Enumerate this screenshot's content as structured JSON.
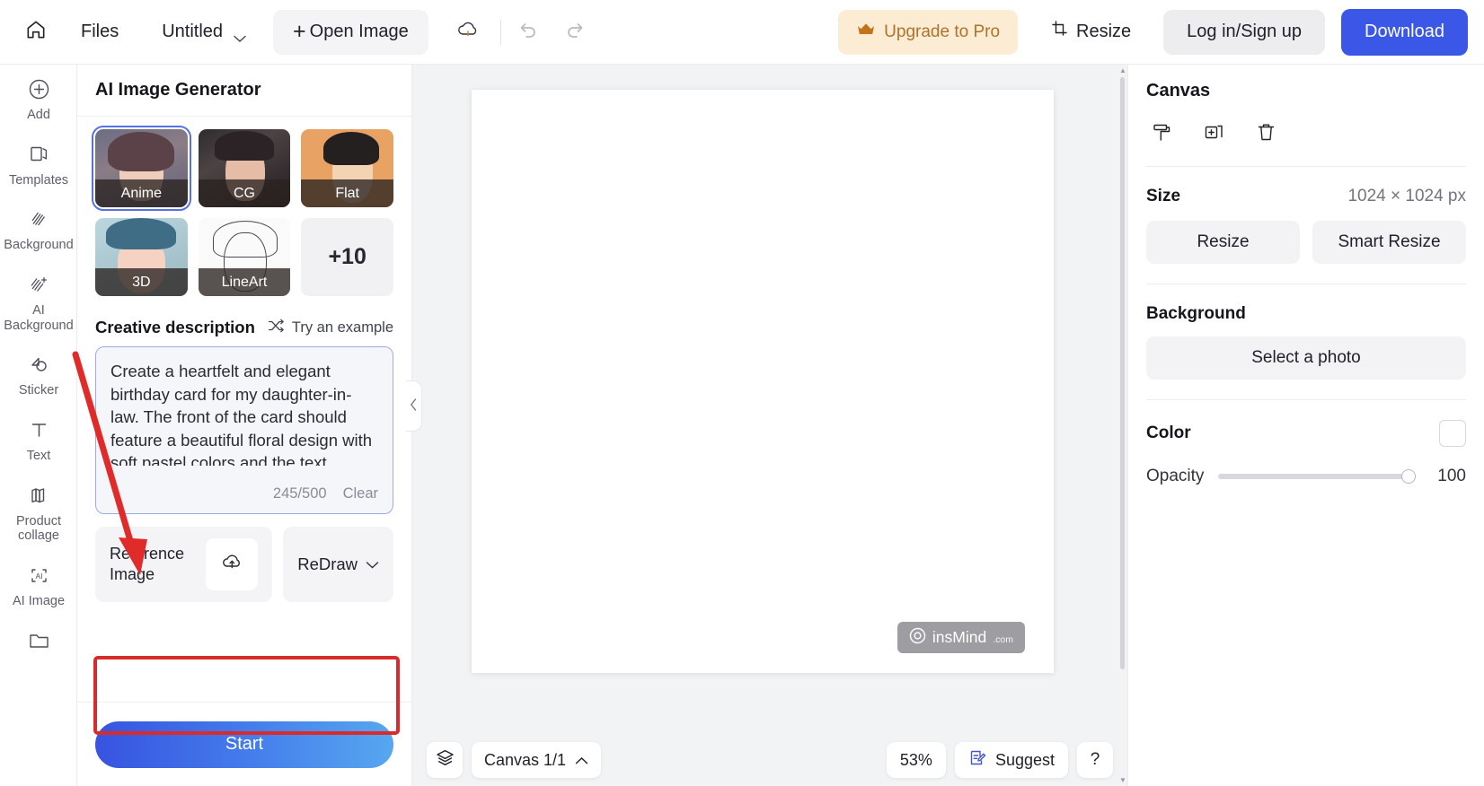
{
  "topbar": {
    "home_icon": "home-icon",
    "files_label": "Files",
    "document_name": "Untitled",
    "open_image_label": "Open Image",
    "open_image_plus": "+",
    "cloud_icon": "cloud-save-icon",
    "undo_icon": "undo-icon",
    "redo_icon": "redo-icon",
    "upgrade_label": "Upgrade to Pro",
    "upgrade_icon": "crown-icon",
    "upgrade_bg": "#fcecd3",
    "upgrade_fg": "#b0722a",
    "resize_label": "Resize",
    "resize_icon": "resize-icon",
    "login_label": "Log in/Sign up",
    "download_label": "Download",
    "download_bg": "#3b57e8"
  },
  "rail": {
    "items": [
      {
        "label": "Add",
        "icon": "plus-circle-icon"
      },
      {
        "label": "Templates",
        "icon": "templates-icon"
      },
      {
        "label": "Background",
        "icon": "background-icon"
      },
      {
        "label": "AI Background",
        "icon": "ai-background-icon"
      },
      {
        "label": "Sticker",
        "icon": "sticker-icon"
      },
      {
        "label": "Text",
        "icon": "text-icon"
      },
      {
        "label": "Product collage",
        "icon": "product-collage-icon"
      },
      {
        "label": "AI Image",
        "icon": "ai-image-icon"
      },
      {
        "label": "",
        "icon": "folder-upload-icon"
      }
    ]
  },
  "panel": {
    "title": "AI Image Generator",
    "styles": [
      {
        "name": "Anime",
        "selected": true,
        "art": "t-anime"
      },
      {
        "name": "CG",
        "selected": false,
        "art": "t-cg"
      },
      {
        "name": "Flat",
        "selected": false,
        "art": "t-flat"
      },
      {
        "name": "3D",
        "selected": false,
        "art": "t-3d"
      },
      {
        "name": "LineArt",
        "selected": false,
        "art": "t-line"
      }
    ],
    "more_styles_label": "+10",
    "description_title": "Creative description",
    "try_example_label": "Try an example",
    "try_example_icon": "shuffle-icon",
    "prompt_value": "Create a heartfelt and elegant birthday card for my daughter-in-law. The front of the card should feature a beautiful floral design with soft pastel colors and the text",
    "char_count": "245/500",
    "clear_label": "Clear",
    "reference_image_label": "Reference Image",
    "upload_icon": "cloud-upload-icon",
    "redraw_label": "ReDraw",
    "redraw_chevron": "chevron-down-icon",
    "start_label": "Start",
    "highlight_color": "#d92b2b",
    "collapse_icon": "chevron-left-icon"
  },
  "canvas": {
    "watermark_text": "insMind",
    "watermark_suffix": ".com",
    "watermark_icon": "insmind-logo-icon"
  },
  "bottombar": {
    "layers_icon": "layers-icon",
    "canvas_pager_label": "Canvas 1/1",
    "pager_chevron": "chevron-up-icon",
    "zoom_level": "53%",
    "suggest_label": "Suggest",
    "suggest_icon": "suggest-icon",
    "help_label": "?"
  },
  "right": {
    "title": "Canvas",
    "tools": [
      {
        "icon": "paint-roller-icon",
        "name": "fill-canvas-tool"
      },
      {
        "icon": "duplicate-icon",
        "name": "duplicate-canvas-tool"
      },
      {
        "icon": "trash-icon",
        "name": "delete-canvas-tool"
      }
    ],
    "size_label": "Size",
    "size_value": "1024 × 1024 px",
    "resize_label": "Resize",
    "smart_resize_label": "Smart Resize",
    "background_label": "Background",
    "select_photo_label": "Select a photo",
    "color_label": "Color",
    "color_value": "#ffffff",
    "opacity_label": "Opacity",
    "opacity_value": "100"
  }
}
